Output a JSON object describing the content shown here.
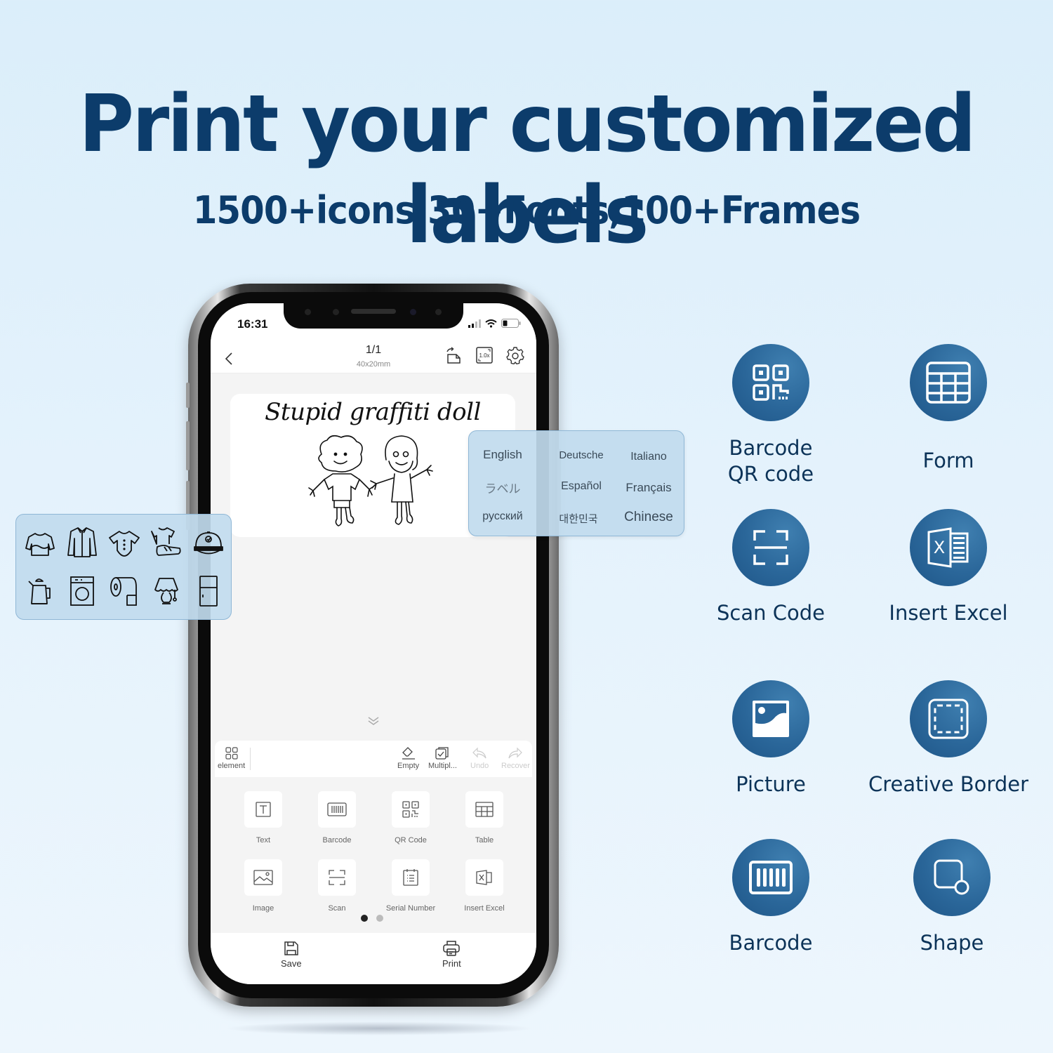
{
  "headline": "Print your customized labels",
  "subheadline": "1500+icons,30+Fonts,100+Frames",
  "phone": {
    "status_bar": {
      "time": "16:31"
    },
    "top_bar": {
      "page_indicator": "1/1",
      "label_size": "40x20mm",
      "zoom_level": "1.0x",
      "icons": [
        "back-icon",
        "rotate-icon",
        "zoom-icon",
        "settings-icon"
      ]
    },
    "label": {
      "title": "Stupid graffiti doll",
      "image": "two-children-doodle"
    },
    "toolbar": {
      "element_label": "element",
      "empty_label": "Empty",
      "multiple_label": "Multipl...",
      "undo_label": "Undo",
      "recover_label": "Recover"
    },
    "elements": [
      {
        "label": "Text",
        "icon": "text-icon"
      },
      {
        "label": "Barcode",
        "icon": "barcode-icon"
      },
      {
        "label": "QR Code",
        "icon": "qr-code-icon"
      },
      {
        "label": "Table",
        "icon": "table-icon"
      },
      {
        "label": "Image",
        "icon": "image-icon"
      },
      {
        "label": "Scan",
        "icon": "scan-icon"
      },
      {
        "label": "Serial Number",
        "icon": "serial-number-icon"
      },
      {
        "label": "Insert Excel",
        "icon": "excel-icon"
      }
    ],
    "pager": {
      "current": 1,
      "total": 2
    },
    "bottom_bar": {
      "save_label": "Save",
      "print_label": "Print"
    }
  },
  "languages": [
    "English",
    "Deutsche",
    "Italiano",
    "ラベル",
    "Español",
    "Français",
    "русский",
    "대한민국",
    "Chinese"
  ],
  "icon_library": [
    "sweater-icon",
    "shirt-icon",
    "baby-onesie-icon",
    "tshirt-sneaker-icon",
    "cap-icon",
    "kettle-icon",
    "washing-machine-icon",
    "toilet-paper-icon",
    "lamp-icon",
    "fridge-icon"
  ],
  "features": [
    {
      "label": "Barcode\nQR code",
      "icon": "qr-code-icon"
    },
    {
      "label": "Form",
      "icon": "table-icon"
    },
    {
      "label": "Scan Code",
      "icon": "scan-icon"
    },
    {
      "label": "Insert Excel",
      "icon": "excel-icon"
    },
    {
      "label": "Picture",
      "icon": "picture-icon"
    },
    {
      "label": "Creative Border",
      "icon": "border-icon"
    },
    {
      "label": "Barcode",
      "icon": "barcode-icon"
    },
    {
      "label": "Shape",
      "icon": "shape-icon"
    }
  ],
  "colors": {
    "headline": "#0c3c6b",
    "feature_circle": "#2a6699",
    "panel_bg": "#c1dbee",
    "pager_active": "#222222",
    "pager_inactive": "#bbbbbb"
  }
}
